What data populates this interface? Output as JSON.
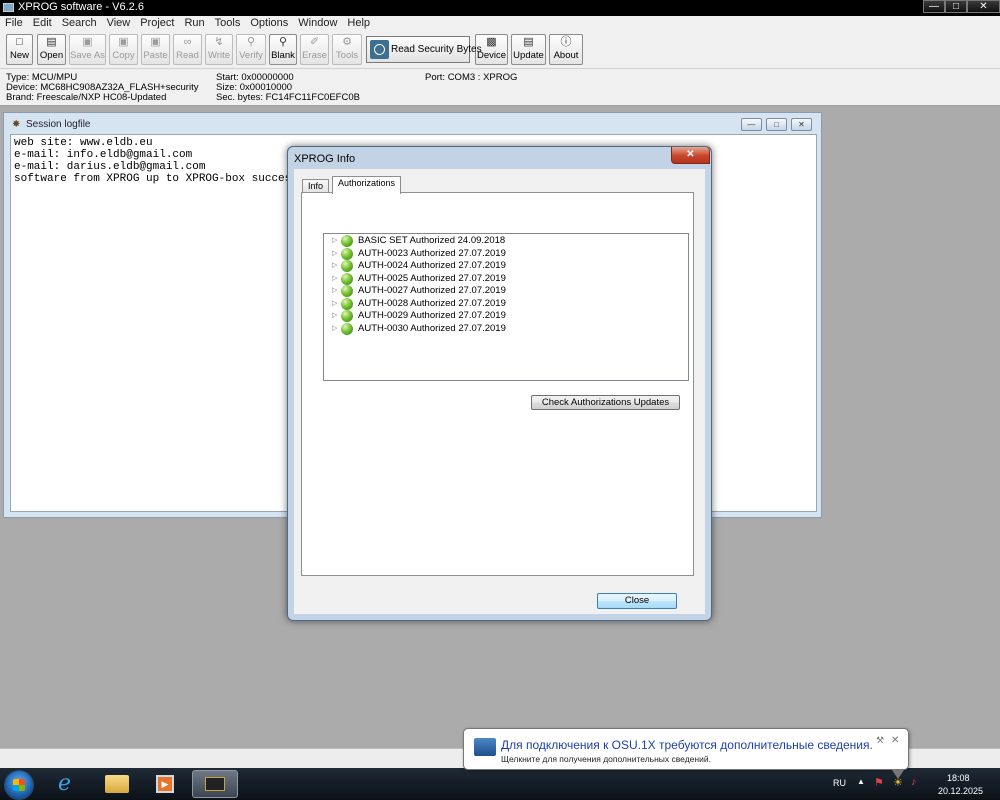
{
  "app": {
    "title": "XPROG software - V6.2.6"
  },
  "menu": [
    "File",
    "Edit",
    "Search",
    "View",
    "Project",
    "Run",
    "Tools",
    "Options",
    "Window",
    "Help"
  ],
  "toolbar": {
    "new": "New",
    "open": "Open",
    "save_as": "Save As",
    "copy": "Copy",
    "paste": "Paste",
    "read": "Read",
    "write": "Write",
    "verify": "Verify",
    "blank": "Blank",
    "erase": "Erase",
    "tools": "Tools",
    "read_security_bytes": "Read Security Bytes",
    "device": "Device",
    "update": "Update",
    "about": "About"
  },
  "device_info": {
    "type": "Type: MCU/MPU",
    "device": "Device: MC68HC908AZ32A_FLASH+security",
    "brand": "Brand: Freescale/NXP HC08-Updated",
    "start": "Start: 0x00000000",
    "size": "Size: 0x00010000",
    "sec_bytes": "Sec. bytes: FC14FC11FC0EFC0B",
    "port": "Port: COM3 : XPROG"
  },
  "session": {
    "title": "Session logfile",
    "lines": [
      "web site: www.eldb.eu",
      "e-mail: info.eldb@gmail.com",
      "e-mail: darius.eldb@gmail.com",
      "software from XPROG up to XPROG-box successf"
    ]
  },
  "dialog": {
    "title": "XPROG Info",
    "tabs": [
      "Info",
      "Authorizations"
    ],
    "active_tab": "Authorizations",
    "authorizations": [
      "BASIC SET Authorized 24.09.2018",
      "AUTH-0023 Authorized 27.07.2019",
      "AUTH-0024 Authorized 27.07.2019",
      "AUTH-0025 Authorized 27.07.2019",
      "AUTH-0027 Authorized 27.07.2019",
      "AUTH-0028 Authorized 27.07.2019",
      "AUTH-0029 Authorized 27.07.2019",
      "AUTH-0030 Authorized 27.07.2019"
    ],
    "check_updates_label": "Check Authorizations Updates",
    "close_label": "Close"
  },
  "notification": {
    "title": "Для подключения к OSU.1X требуются дополнительные сведения.",
    "subtitle": "Щелкните для получения дополнительных сведений."
  },
  "tray": {
    "language": "RU",
    "time": "18:08",
    "date": "20.12.2025"
  },
  "colors": {
    "dialog_frame": "#c2d3e5",
    "status_green": "#78c234",
    "close_red": "#c6452b",
    "taskbar": "#0b1117"
  }
}
